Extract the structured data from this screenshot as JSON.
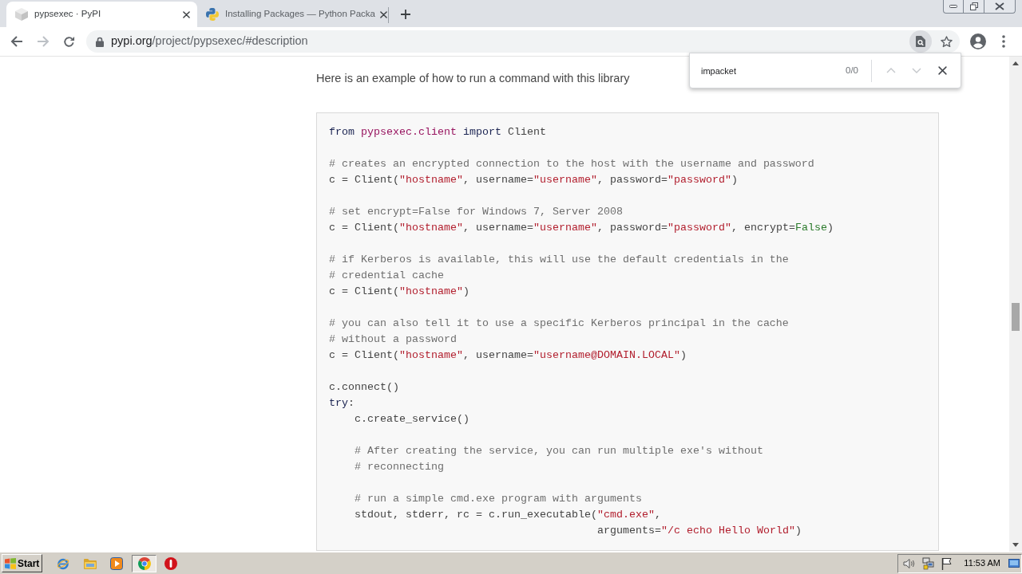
{
  "tabs": [
    {
      "title": "pypsexec · PyPI",
      "selected": true,
      "kind": "cube"
    },
    {
      "title": "Installing Packages — Python Packa",
      "selected": false,
      "kind": "snakes"
    }
  ],
  "navigation": {
    "back": {
      "disabled": false
    },
    "forward": {
      "disabled": true
    }
  },
  "address_bar": {
    "host": "pypi.org",
    "path": "/project/pypsexec/#description"
  },
  "find_bar": {
    "query": "impacket",
    "count": "0/0",
    "previous": {
      "disabled": true
    },
    "next": {
      "disabled": true
    }
  },
  "content": {
    "intro": "Here is an example of how to run a command with this library",
    "code_block": [
      [
        [
          {
            "kind": "keyword",
            "text": "from"
          },
          {
            "kind": "module",
            "text": " pypsexec.client"
          },
          {
            "kind": "keyword",
            "text": " import"
          },
          {
            "kind": "plain",
            "text": " Client"
          }
        ]
      ],
      [
        [
          {
            "kind": "comment",
            "text": "# creates an encrypted connection to the host with the username and password"
          }
        ],
        [
          {
            "kind": "plain",
            "text": "c = Client("
          },
          {
            "kind": "string",
            "text": "\"hostname\""
          },
          {
            "kind": "plain",
            "text": ", username="
          },
          {
            "kind": "string",
            "text": "\"username\""
          },
          {
            "kind": "plain",
            "text": ", password="
          },
          {
            "kind": "string",
            "text": "\"password\""
          },
          {
            "kind": "plain",
            "text": ")"
          }
        ]
      ],
      [
        [
          {
            "kind": "comment",
            "text": "# set encrypt=False for Windows 7, Server 2008"
          }
        ],
        [
          {
            "kind": "plain",
            "text": "c = Client("
          },
          {
            "kind": "string",
            "text": "\"hostname\""
          },
          {
            "kind": "plain",
            "text": ", username="
          },
          {
            "kind": "string",
            "text": "\"username\""
          },
          {
            "kind": "plain",
            "text": ", password="
          },
          {
            "kind": "string",
            "text": "\"password\""
          },
          {
            "kind": "plain",
            "text": ", encrypt="
          },
          {
            "kind": "constant",
            "text": "False"
          },
          {
            "kind": "plain",
            "text": ")"
          }
        ]
      ],
      [
        [
          {
            "kind": "comment",
            "text": "# if Kerberos is available, this will use the default credentials in the"
          }
        ],
        [
          {
            "kind": "comment",
            "text": "# credential cache"
          }
        ],
        [
          {
            "kind": "plain",
            "text": "c = Client("
          },
          {
            "kind": "string",
            "text": "\"hostname\""
          },
          {
            "kind": "plain",
            "text": ")"
          }
        ]
      ],
      [
        [
          {
            "kind": "comment",
            "text": "# you can also tell it to use a specific Kerberos principal in the cache"
          }
        ],
        [
          {
            "kind": "comment",
            "text": "# without a password"
          }
        ],
        [
          {
            "kind": "plain",
            "text": "c = Client("
          },
          {
            "kind": "string",
            "text": "\"hostname\""
          },
          {
            "kind": "plain",
            "text": ", username="
          },
          {
            "kind": "string",
            "text": "\"username@DOMAIN.LOCAL\""
          },
          {
            "kind": "plain",
            "text": ")"
          }
        ]
      ],
      [
        [
          {
            "kind": "plain",
            "text": "c.connect()"
          }
        ],
        [
          {
            "kind": "keyword",
            "text": "try"
          },
          {
            "kind": "plain",
            "text": ":"
          }
        ],
        [
          {
            "kind": "plain",
            "text": "    c.create_service()"
          }
        ]
      ],
      [
        [
          {
            "kind": "comment",
            "text": "    # After creating the service, you can run multiple exe's without"
          }
        ],
        [
          {
            "kind": "comment",
            "text": "    # reconnecting"
          }
        ]
      ],
      [
        [
          {
            "kind": "comment",
            "text": "    # run a simple cmd.exe program with arguments"
          }
        ],
        [
          {
            "kind": "plain",
            "text": "    stdout, stderr, rc = c.run_executable("
          },
          {
            "kind": "string",
            "text": "\"cmd.exe\""
          },
          {
            "kind": "plain",
            "text": ","
          }
        ],
        [
          {
            "kind": "plain",
            "text": "                                          arguments="
          },
          {
            "kind": "string",
            "text": "\"/c echo Hello World\""
          },
          {
            "kind": "plain",
            "text": ")"
          }
        ]
      ]
    ]
  },
  "taskbar": {
    "start": "Start",
    "apps": [
      {
        "kind": "globe",
        "selected": false
      },
      {
        "kind": "folder",
        "selected": false
      },
      {
        "kind": "player",
        "selected": false
      },
      {
        "kind": "wheel",
        "selected": true
      },
      {
        "kind": "ring",
        "selected": false
      }
    ],
    "clock": "11:53 AM"
  }
}
